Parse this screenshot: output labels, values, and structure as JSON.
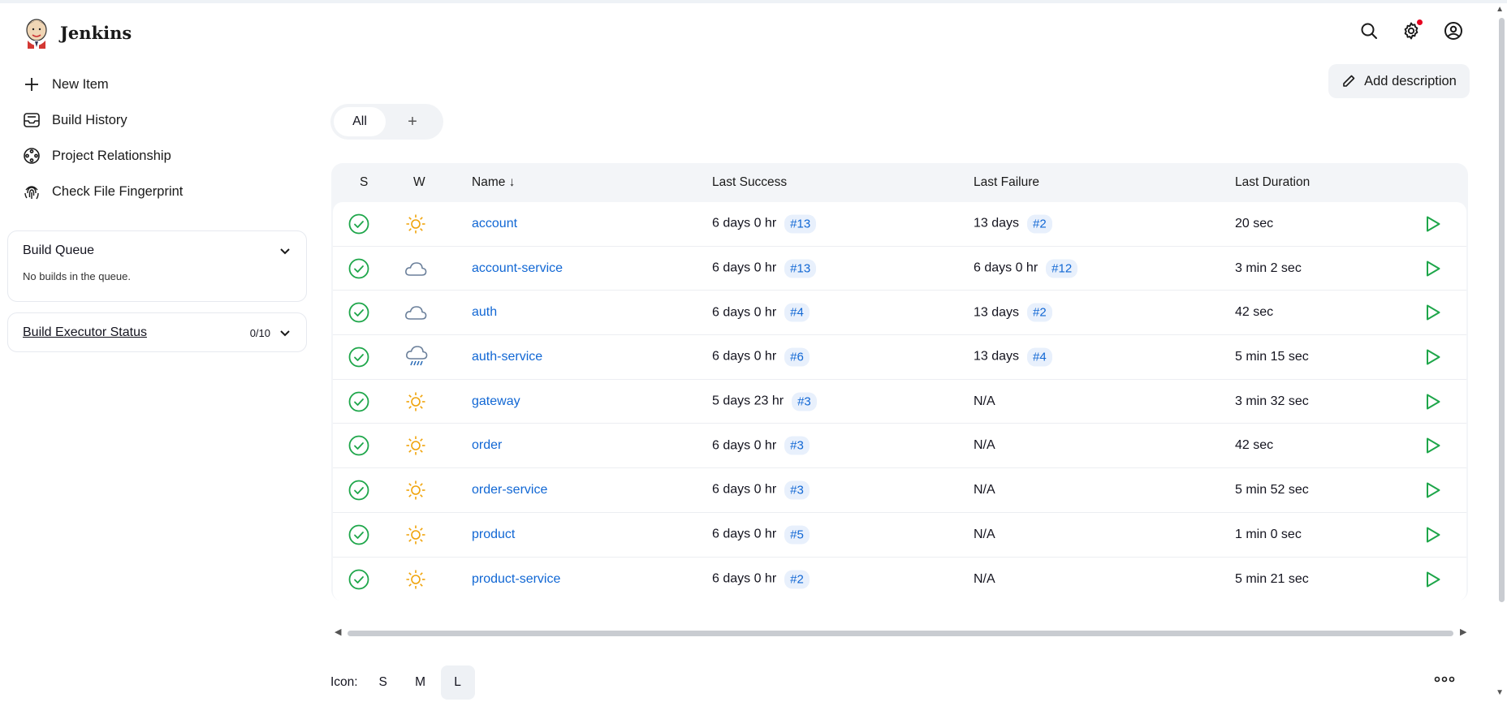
{
  "app": {
    "name": "Jenkins"
  },
  "header": {
    "icons": [
      "search-icon",
      "settings-icon",
      "user-icon"
    ]
  },
  "sidebar": {
    "items": [
      {
        "label": "New Item",
        "icon": "plus-icon"
      },
      {
        "label": "Build History",
        "icon": "inbox-icon"
      },
      {
        "label": "Project Relationship",
        "icon": "relationship-icon"
      },
      {
        "label": "Check File Fingerprint",
        "icon": "fingerprint-icon"
      }
    ],
    "build_queue": {
      "title": "Build Queue",
      "empty": "No builds in the queue."
    },
    "executor": {
      "title": "Build Executor Status",
      "count": "0/10"
    }
  },
  "main": {
    "add_description": "Add description",
    "tabs": {
      "all": "All",
      "add": "+"
    },
    "columns": {
      "s": "S",
      "w": "W",
      "name": "Name ↓",
      "last_success": "Last Success",
      "last_failure": "Last Failure",
      "last_duration": "Last Duration"
    },
    "jobs": [
      {
        "name": "account",
        "weather": "sunny",
        "success_time": "6 days 0 hr",
        "success_build": "#13",
        "failure_time": "13 days",
        "failure_build": "#2",
        "duration": "20 sec"
      },
      {
        "name": "account-service",
        "weather": "cloudy",
        "success_time": "6 days 0 hr",
        "success_build": "#13",
        "failure_time": "6 days 0 hr",
        "failure_build": "#12",
        "duration": "3 min 2 sec"
      },
      {
        "name": "auth",
        "weather": "cloudy",
        "success_time": "6 days 0 hr",
        "success_build": "#4",
        "failure_time": "13 days",
        "failure_build": "#2",
        "duration": "42 sec"
      },
      {
        "name": "auth-service",
        "weather": "rainy",
        "success_time": "6 days 0 hr",
        "success_build": "#6",
        "failure_time": "13 days",
        "failure_build": "#4",
        "duration": "5 min 15 sec"
      },
      {
        "name": "gateway",
        "weather": "sunny",
        "success_time": "5 days 23 hr",
        "success_build": "#3",
        "failure_time": "N/A",
        "failure_build": "",
        "duration": "3 min 32 sec"
      },
      {
        "name": "order",
        "weather": "sunny",
        "success_time": "6 days 0 hr",
        "success_build": "#3",
        "failure_time": "N/A",
        "failure_build": "",
        "duration": "42 sec"
      },
      {
        "name": "order-service",
        "weather": "sunny",
        "success_time": "6 days 0 hr",
        "success_build": "#3",
        "failure_time": "N/A",
        "failure_build": "",
        "duration": "5 min 52 sec"
      },
      {
        "name": "product",
        "weather": "sunny",
        "success_time": "6 days 0 hr",
        "success_build": "#5",
        "failure_time": "N/A",
        "failure_build": "",
        "duration": "1 min 0 sec"
      },
      {
        "name": "product-service",
        "weather": "sunny",
        "success_time": "6 days 0 hr",
        "success_build": "#2",
        "failure_time": "N/A",
        "failure_build": "",
        "duration": "5 min 21 sec"
      }
    ],
    "icon_size": {
      "label": "Icon:",
      "options": [
        "S",
        "M",
        "L"
      ],
      "selected": "L"
    }
  },
  "colors": {
    "link": "#1167d4",
    "success": "#1ea64a",
    "sunny": "#f0a30a",
    "cloud": "#6a7f9a",
    "rain": "#2f6fb8"
  }
}
